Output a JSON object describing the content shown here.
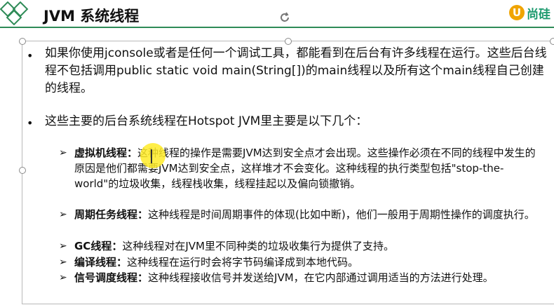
{
  "header": {
    "title": "JVM 系统线程",
    "brand_badge": "U",
    "brand_text": "尚硅"
  },
  "bullets": [
    {
      "text": "如果你使用jconsole或者是任何一个调试工具，都能看到在后台有许多线程在运行。这些后台线程不包括调用public static void main(String[])的main线程以及所有这个main线程自己创建的线程。"
    },
    {
      "text": "这些主要的后台系统线程在Hotspot JVM里主要是以下几个："
    }
  ],
  "sub_items": [
    {
      "term": "虚拟机线程：",
      "desc": "这种线程的操作是需要JVM达到安全点才会出现。这些操作必须在不同的线程中发生的原因是他们都需要JVM达到安全点，这样堆才不会变化。这种线程的执行类型包括\"stop-the-world\"的垃圾收集，线程栈收集，线程挂起以及偏向锁撤销。"
    },
    {
      "term": "周期任务线程：",
      "desc": "这种线程是时间周期事件的体现(比如中断)，他们一般用于周期性操作的调度执行。"
    },
    {
      "term": "GC线程：",
      "desc": "这种线程对在JVM里不同种类的垃圾收集行为提供了支持。"
    },
    {
      "term": "编译线程：",
      "desc": "这种线程在运行时会将字节码编译成到本地代码。"
    },
    {
      "term": "信号调度线程：",
      "desc": "这种线程接收信号并发送给JVM，在它内部通过调用适当的方法进行处理。"
    }
  ],
  "colors": {
    "accent_green": "#2e8b57",
    "brand_orange": "#f0a400",
    "brand_green": "#1e9b6f",
    "cursor_yellow": "#ffeb28"
  }
}
